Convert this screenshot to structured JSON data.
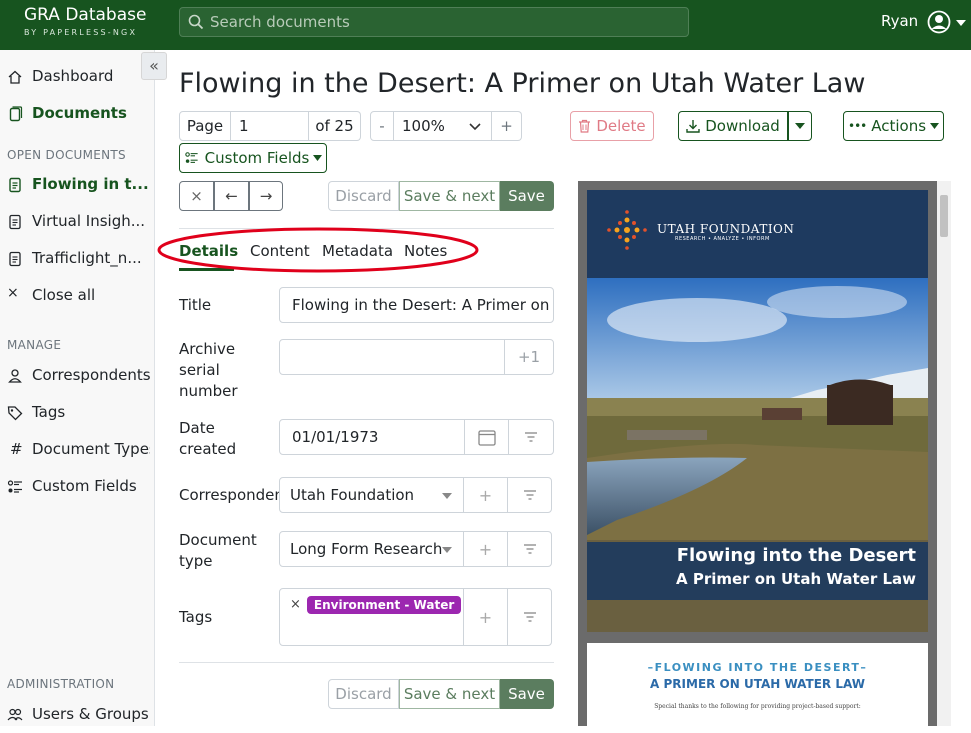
{
  "header": {
    "brand_title": "GRA Database",
    "brand_subtitle": "BY PAPERLESS-NGX",
    "search_placeholder": "Search documents",
    "user_name": "Ryan"
  },
  "sidebar": {
    "collapse_icon": "«",
    "items": [
      {
        "label": "Dashboard",
        "icon": "house-icon"
      },
      {
        "label": "Documents",
        "icon": "files-icon",
        "active": true
      }
    ],
    "open_documents_heading": "OPEN DOCUMENTS",
    "open_documents": [
      {
        "label": "Flowing in t...",
        "active": true
      },
      {
        "label": "Virtual Insigh..."
      },
      {
        "label": "Trafficlight_n..."
      }
    ],
    "close_all": "Close all",
    "manage_heading": "MANAGE",
    "manage_items": [
      {
        "label": "Correspondents",
        "icon": "person-icon"
      },
      {
        "label": "Tags",
        "icon": "tag-icon"
      },
      {
        "label": "Document Types",
        "icon": "hash-icon"
      },
      {
        "label": "Custom Fields",
        "icon": "ui-radios-icon"
      }
    ],
    "administration_heading": "ADMINISTRATION",
    "admin_items": [
      {
        "label": "Users & Groups",
        "icon": "people-icon"
      }
    ]
  },
  "document": {
    "title": "Flowing in the Desert: A Primer on Utah Water Law"
  },
  "toolbar": {
    "page_label": "Page",
    "page_value": "1",
    "page_of": "of 25",
    "zoom_minus": "-",
    "zoom_value": "100%",
    "zoom_plus": "+",
    "delete_label": "Delete",
    "download_label": "Download",
    "actions_label": "Actions",
    "custom_fields_label": "Custom Fields"
  },
  "nav_buttons": {
    "close": "×",
    "prev": "←",
    "next": "→"
  },
  "save_bar": {
    "discard": "Discard",
    "save_next": "Save & next",
    "save": "Save"
  },
  "tabs": [
    {
      "label": "Details",
      "active": true
    },
    {
      "label": "Content"
    },
    {
      "label": "Metadata"
    },
    {
      "label": "Notes"
    }
  ],
  "form": {
    "title_label": "Title",
    "title_value": "Flowing in the Desert: A Primer on Utah Water Law",
    "asn_label_lines": [
      "Archive",
      "serial",
      "number"
    ],
    "asn_value": "",
    "asn_increment": "+1",
    "date_label_lines": [
      "Date",
      "created"
    ],
    "date_value": "01/01/1973",
    "correspondent_label": "Correspondent",
    "correspondent_value": "Utah Foundation",
    "doctype_label_lines": [
      "Document",
      "type"
    ],
    "doctype_value": "Long Form Research",
    "tags_label": "Tags",
    "tags": [
      {
        "label": "Environment - Water",
        "color": "#9c27b0"
      }
    ],
    "add_symbol": "+",
    "remove_symbol": "×"
  },
  "preview": {
    "org_name": "UTAH FOUNDATION",
    "org_tagline": "RESEARCH • ANALYZE • INFORM",
    "cover_title_line1": "Flowing into the Desert",
    "cover_title_line2": "A Primer on Utah Water Law",
    "page2_heading1": "–FLOWING INTO THE DESERT–",
    "page2_heading2": "A PRIMER ON UTAH WATER LAW",
    "page2_text": "Special thanks to the following for providing project-based support:"
  },
  "colors": {
    "brand_green": "#17541f",
    "delete_red": "#dc3545",
    "tag_purple": "#9c27b0",
    "save_green": "#5b7d5f",
    "annotation_red": "#e0001b"
  }
}
